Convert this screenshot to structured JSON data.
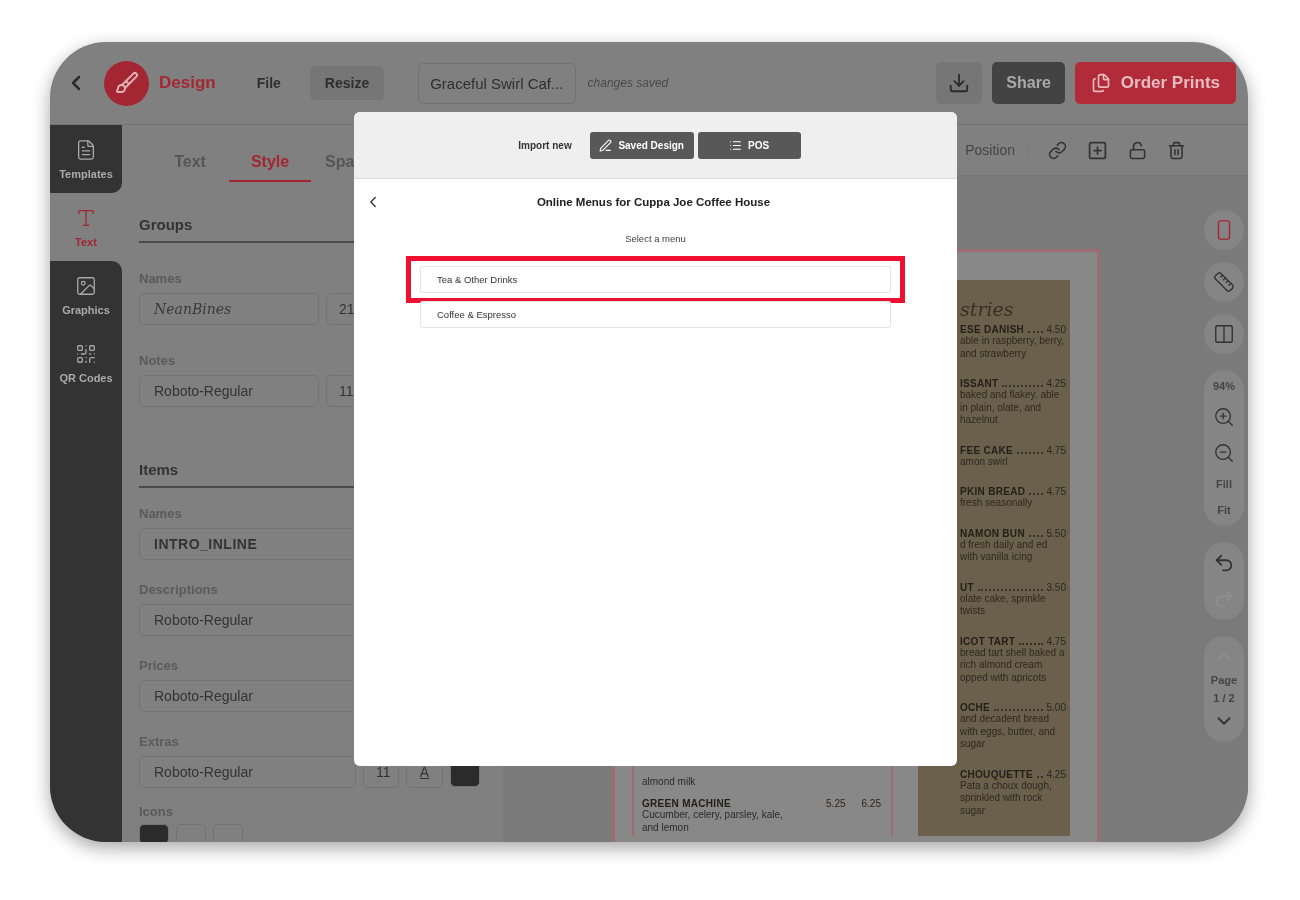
{
  "top_bar": {
    "app_name": "Design",
    "menu": [
      {
        "label": "File",
        "kind": "plain"
      },
      {
        "label": "Resize",
        "kind": "filled"
      }
    ],
    "document_title": "Graceful Swirl Caf...",
    "save_status": "changes saved",
    "share": "Share",
    "order": "Order Prints"
  },
  "rail": [
    {
      "label": "Templates",
      "kind": "templates",
      "selected": false
    },
    {
      "label": "Text",
      "kind": "text",
      "selected": true
    },
    {
      "label": "Graphics",
      "kind": "graphics",
      "selected": false
    },
    {
      "label": "QR Codes",
      "kind": "qr",
      "selected": false
    }
  ],
  "panel": {
    "tabs": [
      {
        "label": "Text",
        "selected": false
      },
      {
        "label": "Style",
        "selected": true
      },
      {
        "label": "Spa",
        "selected": false
      }
    ],
    "sections": [
      {
        "title": "Groups",
        "fields": [
          {
            "label": "Names",
            "font": "NeanBines",
            "kind": "script",
            "size": "21"
          },
          {
            "label": "Notes",
            "font": "Roboto-Regular",
            "kind": "plain",
            "size": "11"
          }
        ]
      },
      {
        "title": "Items",
        "fields": [
          {
            "label": "Names",
            "font": "INTRO_INLINE",
            "kind": "display"
          },
          {
            "label": "Descriptions",
            "font": "Roboto-Regular",
            "kind": "plain"
          },
          {
            "label": "Prices",
            "font": "Roboto-Regular",
            "kind": "plain"
          },
          {
            "label": "Extras",
            "font": "Roboto-Regular",
            "kind": "plain",
            "size": "11",
            "style_button": "A",
            "color": "#2b2b2b"
          }
        ]
      }
    ],
    "icons_label": "Icons",
    "icon_swatches": [
      {
        "color": "#2b2b2b"
      },
      {
        "color": "#808080"
      },
      {
        "color": "#808080"
      }
    ]
  },
  "canvas_toolbar": {
    "position": "Position"
  },
  "document": {
    "left_column": {
      "partial_description": "almond milk",
      "items": [
        {
          "name": "GREEN MACHINE",
          "prices": [
            "5.25",
            "6.25"
          ],
          "description": "Cucumber, celery, parsley, kale, and lemon"
        }
      ]
    },
    "right_column": {
      "heading": "stries",
      "items": [
        {
          "name": "ESE DANISH",
          "price": "4.50",
          "description": "able in raspberry, berry, and strawberry"
        },
        {
          "name": "ISSANT",
          "price": "4.25",
          "description": "baked and flakey. able in plain, olate, and hazelnut"
        },
        {
          "name": "FEE CAKE",
          "price": "4.75",
          "description": "amon swirl"
        },
        {
          "name": "PKIN BREAD",
          "price": "4.75",
          "description": "fresh seasonally"
        },
        {
          "name": "NAMON BUN",
          "price": "5.50",
          "description": "d fresh daily and ed with vanilla icing"
        },
        {
          "name": "UT",
          "price": "3.50",
          "description": "olate cake, sprinkle twists"
        },
        {
          "name": "ICOT TART",
          "price": "4.75",
          "description": "bread tart shell baked a rich almond cream opped with apricots"
        },
        {
          "name": "OCHE",
          "price": "5.00",
          "description": "and decadent bread with eggs, butter, and sugar"
        },
        {
          "name": "CHOUQUETTE",
          "price": "4.25",
          "description": "Pata a choux dough, sprinkled with rock sugar"
        }
      ]
    }
  },
  "tools": {
    "view": [
      {
        "kind": "page",
        "selected": true
      },
      {
        "kind": "ruler",
        "selected": false
      },
      {
        "kind": "columns",
        "selected": false
      }
    ],
    "zoom": "94%",
    "fill": "Fill",
    "fit": "Fit",
    "history": [
      {
        "kind": "undo",
        "disabled": false
      },
      {
        "kind": "redo",
        "disabled": true
      }
    ],
    "page_label": "Page",
    "page_number": "1 / 2",
    "page_nav": [
      {
        "kind": "up",
        "disabled": true
      },
      {
        "kind": "down",
        "disabled": false
      }
    ]
  },
  "modal": {
    "import_label": "Import new",
    "sources": [
      {
        "label": "Saved Design",
        "kind": "design"
      },
      {
        "label": "POS",
        "kind": "pos"
      }
    ],
    "title": "Online Menus for Cuppa Joe Coffee House",
    "prompt": "Select a menu",
    "menus": [
      {
        "label": "Tea & Other Drinks",
        "selected": true
      },
      {
        "label": "Coffee & Espresso",
        "selected": false
      }
    ]
  }
}
